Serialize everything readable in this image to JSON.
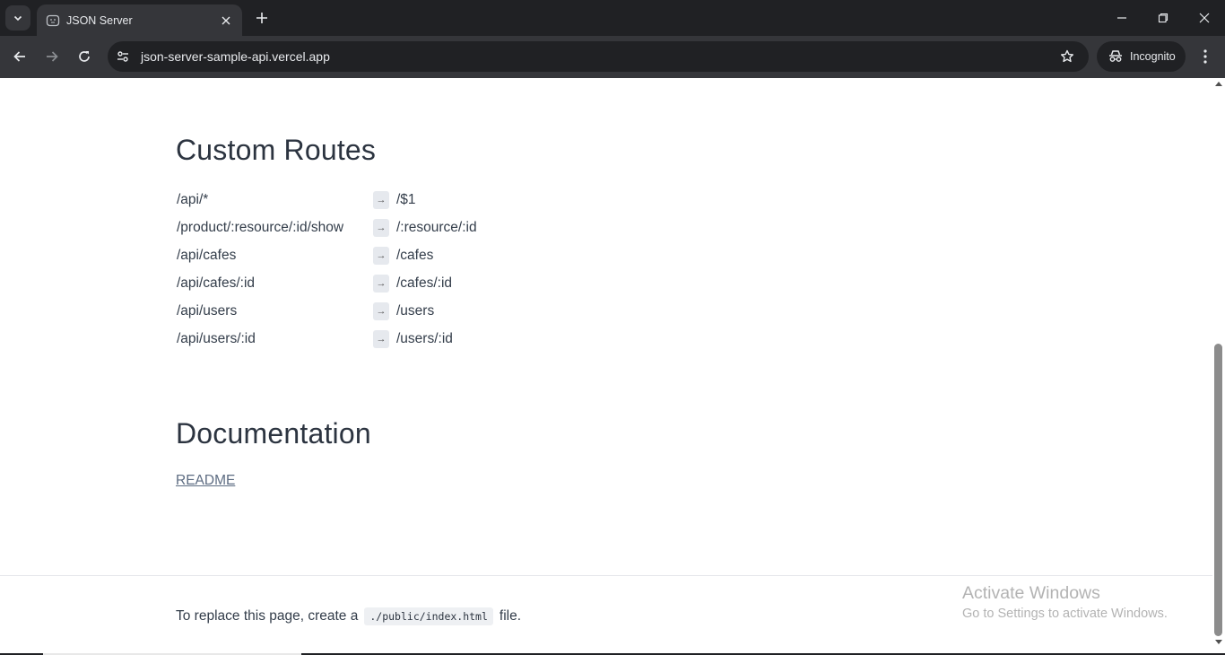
{
  "browser": {
    "tab": {
      "title": "JSON Server",
      "favicon": "json-server-face-icon"
    },
    "url": "json-server-sample-api.vercel.app",
    "incognito_label": "Incognito",
    "accent": "#35363a"
  },
  "page": {
    "custom_routes_heading": "Custom Routes",
    "routes": [
      {
        "from": "/api/*",
        "arrow": "→",
        "to": "/$1"
      },
      {
        "from": "/product/:resource/:id/show",
        "arrow": "→",
        "to": "/:resource/:id"
      },
      {
        "from": "/api/cafes",
        "arrow": "→",
        "to": "/cafes"
      },
      {
        "from": "/api/cafes/:id",
        "arrow": "→",
        "to": "/cafes/:id"
      },
      {
        "from": "/api/users",
        "arrow": "→",
        "to": "/users"
      },
      {
        "from": "/api/users/:id",
        "arrow": "→",
        "to": "/users/:id"
      }
    ],
    "documentation_heading": "Documentation",
    "readme_link": "README",
    "footer": {
      "before": "To replace this page, create a",
      "code": "./public/index.html",
      "after": "file."
    }
  },
  "watermark": {
    "line1": "Activate Windows",
    "line2": "Go to Settings to activate Windows."
  }
}
